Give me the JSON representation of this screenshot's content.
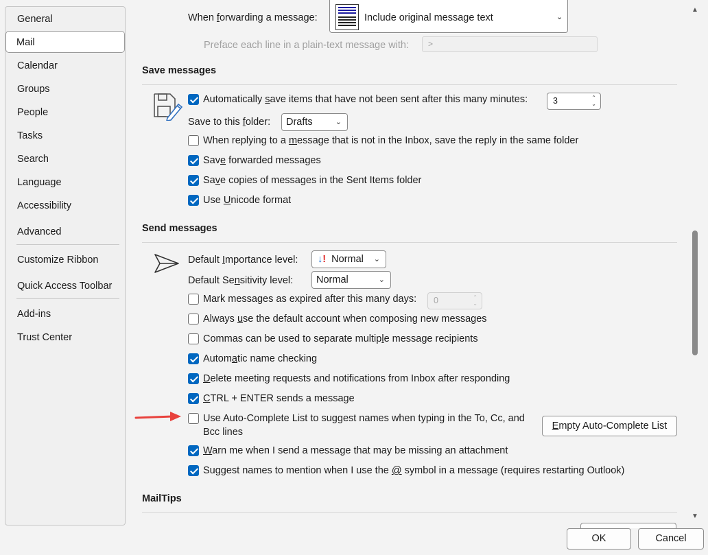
{
  "sidebar": {
    "items": [
      {
        "label": "General"
      },
      {
        "label": "Mail"
      },
      {
        "label": "Calendar"
      },
      {
        "label": "Groups"
      },
      {
        "label": "People"
      },
      {
        "label": "Tasks"
      },
      {
        "label": "Search"
      },
      {
        "label": "Language"
      },
      {
        "label": "Accessibility"
      },
      {
        "label": "Advanced"
      },
      {
        "label": "Customize Ribbon"
      },
      {
        "label": "Quick Access Toolbar"
      },
      {
        "label": "Add-ins"
      },
      {
        "label": "Trust Center"
      }
    ],
    "selected": "Mail"
  },
  "forwarding": {
    "label_pre": "When ",
    "label_ul": "f",
    "label_post": "orwarding a message:",
    "value": "Include original message text",
    "preface_label": "Preface each line in a plain-text message with:",
    "preface_value": ">"
  },
  "save_messages": {
    "title": "Save messages",
    "autosave_pre": "Automatically ",
    "autosave_ul": "s",
    "autosave_post": "ave items that have not been sent after this many minutes:",
    "autosave_checked": true,
    "autosave_minutes": "3",
    "folder_label_pre": "Save to this ",
    "folder_label_ul": "f",
    "folder_label_post": "older:",
    "folder_value": "Drafts",
    "reply_pre": "When replying to a ",
    "reply_ul": "m",
    "reply_post": "essage that is not in the Inbox, save the reply in the same folder",
    "reply_checked": false,
    "forwarded_pre": "Sav",
    "forwarded_ul": "e",
    "forwarded_post": " forwarded messages",
    "forwarded_checked": true,
    "sent_copies_pre": "Sa",
    "sent_copies_ul": "v",
    "sent_copies_post": "e copies of messages in the Sent Items folder",
    "sent_copies_checked": true,
    "unicode_pre": "Use ",
    "unicode_ul": "U",
    "unicode_post": "nicode format",
    "unicode_checked": true
  },
  "send_messages": {
    "title": "Send messages",
    "importance_label_pre": "Default ",
    "importance_label_ul": "I",
    "importance_label_post": "mportance level:",
    "importance_value": "Normal",
    "sensitivity_label_pre": "Default Se",
    "sensitivity_label_ul": "n",
    "sensitivity_label_post": "sitivity level:",
    "sensitivity_value": "Normal",
    "expire_pre": "Mark messa",
    "expire_ul": "g",
    "expire_post": "es as expired after this many days:",
    "expire_checked": false,
    "expire_days": "0",
    "default_account_pre": "Always ",
    "default_account_ul": "u",
    "default_account_post": "se the default account when composing new messages",
    "default_account_checked": false,
    "commas_pre": "Commas can be used to separate multip",
    "commas_ul": "l",
    "commas_post": "e message recipients",
    "commas_checked": false,
    "name_check_pre": "Autom",
    "name_check_ul": "a",
    "name_check_post": "tic name checking",
    "name_check_checked": true,
    "delete_meeting_pre": "",
    "delete_meeting_ul": "D",
    "delete_meeting_post": "elete meeting requests and notifications from Inbox after responding",
    "delete_meeting_checked": true,
    "ctrl_enter_pre": "",
    "ctrl_enter_ul": "C",
    "ctrl_enter_post": "TRL + ENTER sends a message",
    "ctrl_enter_checked": true,
    "autocomplete_line1_pre": "Use Auto-Complete List to su",
    "autocomplete_line1_ul": "g",
    "autocomplete_line1_post": "gest names when typing in the To, Cc, and",
    "autocomplete_line2": "Bcc lines",
    "autocomplete_checked": false,
    "empty_autocomplete_pre": "",
    "empty_autocomplete_ul": "E",
    "empty_autocomplete_post": "mpty Auto-Complete List",
    "warn_pre": "",
    "warn_ul": "W",
    "warn_post": "arn me when I send a message that may be missing an attachment",
    "warn_checked": true,
    "mention_pre": "Suggest names to mention when I use the ",
    "mention_ul": "@",
    "mention_post": " symbol in a message (requires restarting Outlook)",
    "mention_checked": true
  },
  "mailtips": {
    "title": "MailTips"
  },
  "footer": {
    "ok": "OK",
    "cancel": "Cancel"
  },
  "colors": {
    "accent": "#0067c0",
    "arrow": "#e8413c"
  }
}
